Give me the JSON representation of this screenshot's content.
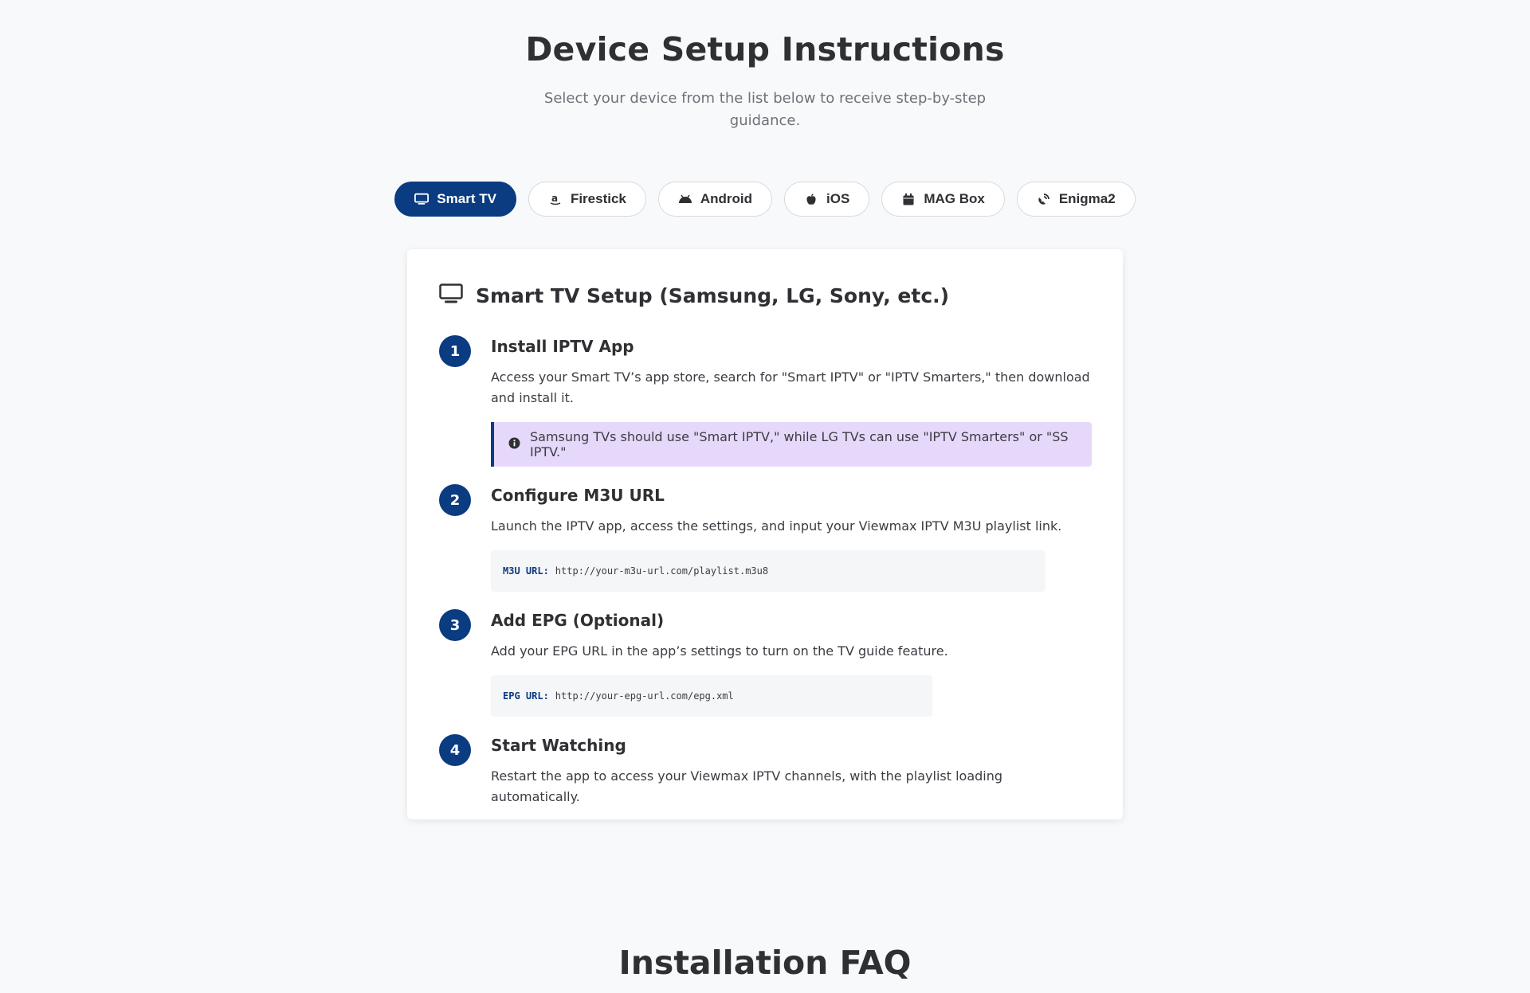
{
  "hero": {
    "title": "Device Setup Instructions",
    "subtitle": "Select your device from the list below to receive step-by-step guidance."
  },
  "tabs": [
    {
      "label": "Smart TV",
      "icon": "tv-icon",
      "active": true
    },
    {
      "label": "Firestick",
      "icon": "amazon-icon",
      "active": false
    },
    {
      "label": "Android",
      "icon": "android-icon",
      "active": false
    },
    {
      "label": "iOS",
      "icon": "apple-icon",
      "active": false
    },
    {
      "label": "MAG Box",
      "icon": "box-icon",
      "active": false
    },
    {
      "label": "Enigma2",
      "icon": "satellite-icon",
      "active": false
    }
  ],
  "card": {
    "icon": "tv-icon",
    "title": "Smart TV Setup (Samsung, LG, Sony, etc.)",
    "steps": [
      {
        "number": "1",
        "title": "Install IPTV App",
        "text": "Access your Smart TV’s app store, search for \"Smart IPTV\" or \"IPTV Smarters,\" then download and install it.",
        "note": "Samsung TVs should use \"Smart IPTV,\" while LG TVs can use \"IPTV Smarters\" or \"SS IPTV.\""
      },
      {
        "number": "2",
        "title": "Configure M3U URL",
        "text": "Launch the IPTV app, access the settings, and input your Viewmax IPTV M3U playlist link.",
        "code_key": "M3U URL:",
        "code_value": "http://your-m3u-url.com/playlist.m3u8"
      },
      {
        "number": "3",
        "title": "Add EPG (Optional)",
        "text": "Add your EPG URL in the app’s settings to turn on the TV guide feature.",
        "code_key": "EPG URL:",
        "code_value": "http://your-epg-url.com/epg.xml"
      },
      {
        "number": "4",
        "title": "Start Watching",
        "text": "Restart the app to access your Viewmax IPTV channels, with the playlist loading automatically."
      }
    ]
  },
  "faq": {
    "title": "Installation FAQ"
  },
  "colors": {
    "primary": "#0b3b80",
    "note_bg": "#e6d8fa",
    "page_bg": "#f8f9fb"
  }
}
